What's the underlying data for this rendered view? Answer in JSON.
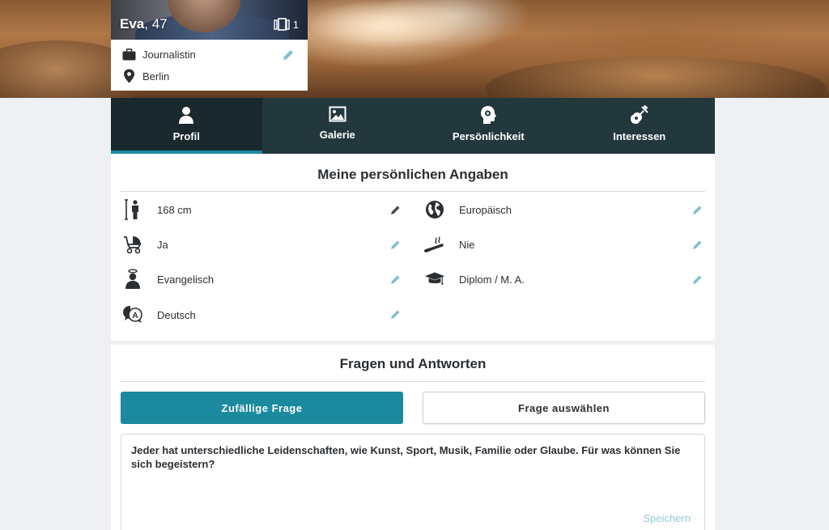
{
  "colors": {
    "accent": "#1b8a9e",
    "tab_bg": "#23383d",
    "tab_active_bg": "#19292d",
    "pencil": "#7fbfd0"
  },
  "profile": {
    "name": "Eva",
    "age": ", 47",
    "photo_count": "1",
    "job": "Journalistin",
    "city": "Berlin"
  },
  "tabs": [
    {
      "label": "Profil",
      "icon": "person-icon",
      "active": true
    },
    {
      "label": "Galerie",
      "icon": "picture-icon",
      "active": false
    },
    {
      "label": "Persönlichkeit",
      "icon": "head-gear-icon",
      "active": false
    },
    {
      "label": "Interessen",
      "icon": "guitar-icon",
      "active": false
    }
  ],
  "details": {
    "title": "Meine persönlichen Angaben",
    "items": [
      {
        "icon": "height-icon",
        "value": "168 cm"
      },
      {
        "icon": "globe-icon",
        "value": "Europäisch"
      },
      {
        "icon": "stroller-icon",
        "value": "Ja"
      },
      {
        "icon": "cigarette-icon",
        "value": "Nie"
      },
      {
        "icon": "religion-icon",
        "value": "Evangelisch"
      },
      {
        "icon": "graduation-cap-icon",
        "value": "Diplom / M. A."
      },
      {
        "icon": "language-icon",
        "value": "Deutsch"
      }
    ]
  },
  "qa": {
    "title": "Fragen und Antworten",
    "random_button": "Zufällige Frage",
    "choose_button": "Frage auswählen",
    "question": "Jeder hat unterschiedliche Leidenschaften, wie Kunst, Sport, Musik, Familie oder Glaube. Für was können Sie sich begeistern?",
    "save_label": "Speichern"
  }
}
